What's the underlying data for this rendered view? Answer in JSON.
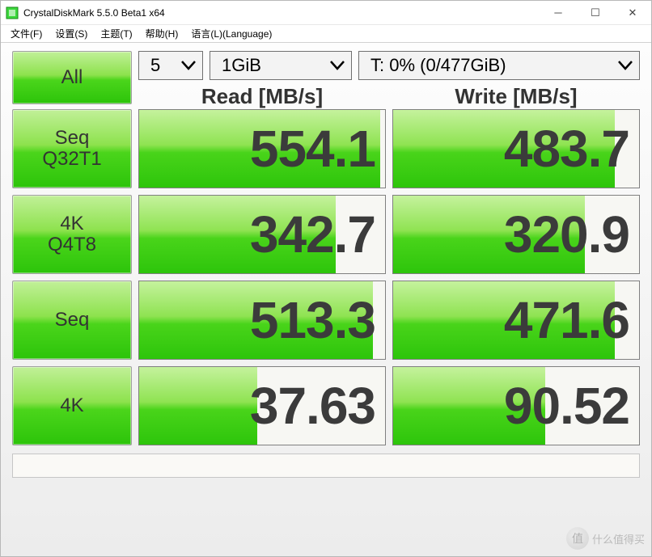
{
  "window": {
    "title": "CrystalDiskMark 5.5.0 Beta1 x64",
    "min_tooltip": "Minimize",
    "max_tooltip": "Maximize",
    "close_tooltip": "Close"
  },
  "menu": {
    "file": "文件(F)",
    "settings": "设置(S)",
    "theme": "主题(T)",
    "help": "帮助(H)",
    "language": "语言(L)(Language)"
  },
  "controls": {
    "all_label": "All",
    "loops_value": "5",
    "size_value": "1GiB",
    "drive_value": "T: 0% (0/477GiB)"
  },
  "headers": {
    "read": "Read [MB/s]",
    "write": "Write [MB/s]"
  },
  "tests": [
    {
      "label_line1": "Seq",
      "label_line2": "Q32T1",
      "read": "554.1",
      "write": "483.7",
      "read_fill": 98,
      "write_fill": 90
    },
    {
      "label_line1": "4K",
      "label_line2": "Q4T8",
      "read": "342.7",
      "write": "320.9",
      "read_fill": 80,
      "write_fill": 78
    },
    {
      "label_line1": "Seq",
      "label_line2": "",
      "read": "513.3",
      "write": "471.6",
      "read_fill": 95,
      "write_fill": 90
    },
    {
      "label_line1": "4K",
      "label_line2": "",
      "read": "37.63",
      "write": "90.52",
      "read_fill": 48,
      "write_fill": 62
    }
  ],
  "watermark": {
    "coin": "值",
    "text": "什么值得买"
  }
}
